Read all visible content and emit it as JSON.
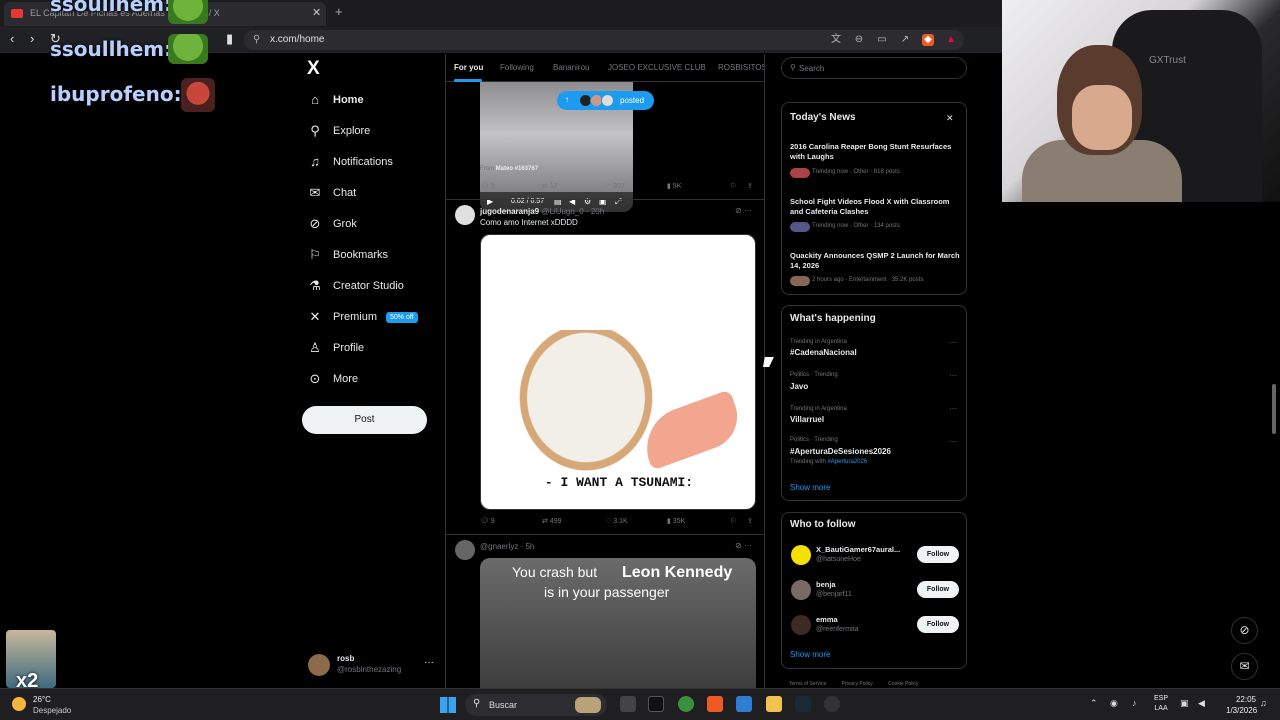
{
  "browser": {
    "tab_title": "EL Capitán De Pichas es Ademas Pa... · me / X",
    "url_site_icon": "site-info-icon",
    "url": "x.com/home"
  },
  "overlay": {
    "chat": [
      {
        "name": "ssoullhem:",
        "emote": "pepe-emote"
      },
      {
        "name": "ssoullhem:",
        "emote": "pepe-emote"
      },
      {
        "name": "ibuprofeno:",
        "emote": "face-emote"
      }
    ],
    "webcam_brand": "GXTrust",
    "multiplier": "x2"
  },
  "nav": {
    "logo": "X",
    "items": [
      {
        "label": "Home",
        "icon": "home-icon"
      },
      {
        "label": "Explore",
        "icon": "search-icon"
      },
      {
        "label": "Notifications",
        "icon": "bell-icon"
      },
      {
        "label": "Chat",
        "icon": "mail-icon"
      },
      {
        "label": "Grok",
        "icon": "grok-icon"
      },
      {
        "label": "Bookmarks",
        "icon": "bookmark-icon"
      },
      {
        "label": "Creator Studio",
        "icon": "creator-studio-icon"
      },
      {
        "label": "Premium",
        "icon": "x-premium-icon",
        "badge": "50% off"
      },
      {
        "label": "Profile",
        "icon": "person-icon"
      },
      {
        "label": "More",
        "icon": "more-icon"
      }
    ],
    "post_label": "Post",
    "account": {
      "name": "rosb",
      "handle": "@rosbinthezazing"
    }
  },
  "timeline": {
    "tabs": [
      "For you",
      "Following",
      "Bananirou",
      "JOSEO EXCLUSIVE CLUB",
      "ROSBISITOS"
    ],
    "posted_pill": "posted",
    "tweet1": {
      "video_time": "0:02 / 0:57",
      "from_prefix": "From",
      "from_name": "Mateo #163767",
      "replies": "1",
      "reposts": "17",
      "likes": "307",
      "views": "5K"
    },
    "tweet2": {
      "display_name": "jugodenaranja9",
      "handle_time": "@LiUugo_0 · 20h",
      "text": "Como amo Internet xDDDD",
      "image_caption": "- I WANT A TSUNAMI:",
      "replies": "9",
      "reposts": "499",
      "likes": "3.1K",
      "views": "35K"
    },
    "tweet3": {
      "handle_time": "@gnaerlyz · 5h",
      "meme_line1": "You crash but",
      "meme_line2": "Leon Kennedy",
      "meme_line3": "is in your passenger"
    }
  },
  "right": {
    "search_placeholder": "Search",
    "news": {
      "title": "Today's News",
      "items": [
        {
          "headline": "2016 Carolina Reaper Bong Stunt Resurfaces with Laughs",
          "meta": "Trending now · Other · 618 posts"
        },
        {
          "headline": "School Fight Videos Flood X with Classroom and Cafeteria Clashes",
          "meta": "Trending now · Other · 134 posts"
        },
        {
          "headline": "Quackity Announces QSMP 2 Launch for March 14, 2026",
          "meta": "2 hours ago · Entertainment · 35.2K posts"
        }
      ]
    },
    "happening": {
      "title": "What's happening",
      "items": [
        {
          "meta": "Trending in Argentina",
          "name": "#CadenaNacional",
          "sub": ""
        },
        {
          "meta": "Politics · Trending",
          "name": "Javo",
          "sub": ""
        },
        {
          "meta": "Trending in Argentina",
          "name": "Villarruel",
          "sub": ""
        },
        {
          "meta": "Politics · Trending",
          "name": "#AperturaDeSesiones2026",
          "sub_prefix": "Trending with",
          "sub_tag": "#Apertura2026"
        }
      ],
      "show_more": "Show more"
    },
    "follow": {
      "title": "Who to follow",
      "users": [
        {
          "name": "X_BautiGamer67aural...",
          "handle": "@hatsuneHoe",
          "avatar_color": "#f5e000"
        },
        {
          "name": "benja",
          "handle": "@benjarf11",
          "avatar_color": "#7a6a66"
        },
        {
          "name": "emma",
          "handle": "@reenfermita",
          "avatar_color": "#3d2a24"
        }
      ],
      "follow_label": "Follow",
      "show_more": "Show more"
    },
    "footer": [
      "Terms of Service",
      "Privacy Policy",
      "Cookie Policy"
    ]
  },
  "taskbar": {
    "temp": "26°C",
    "weather": "Despejado",
    "search": "Buscar",
    "lang_1": "ESP",
    "lang_2": "LAA",
    "time": "22:05",
    "date": "1/3/2026"
  },
  "colors": {
    "accent": "#1d9bf0",
    "background": "#000000",
    "text": "#e7e9ea",
    "muted": "#71767b"
  }
}
